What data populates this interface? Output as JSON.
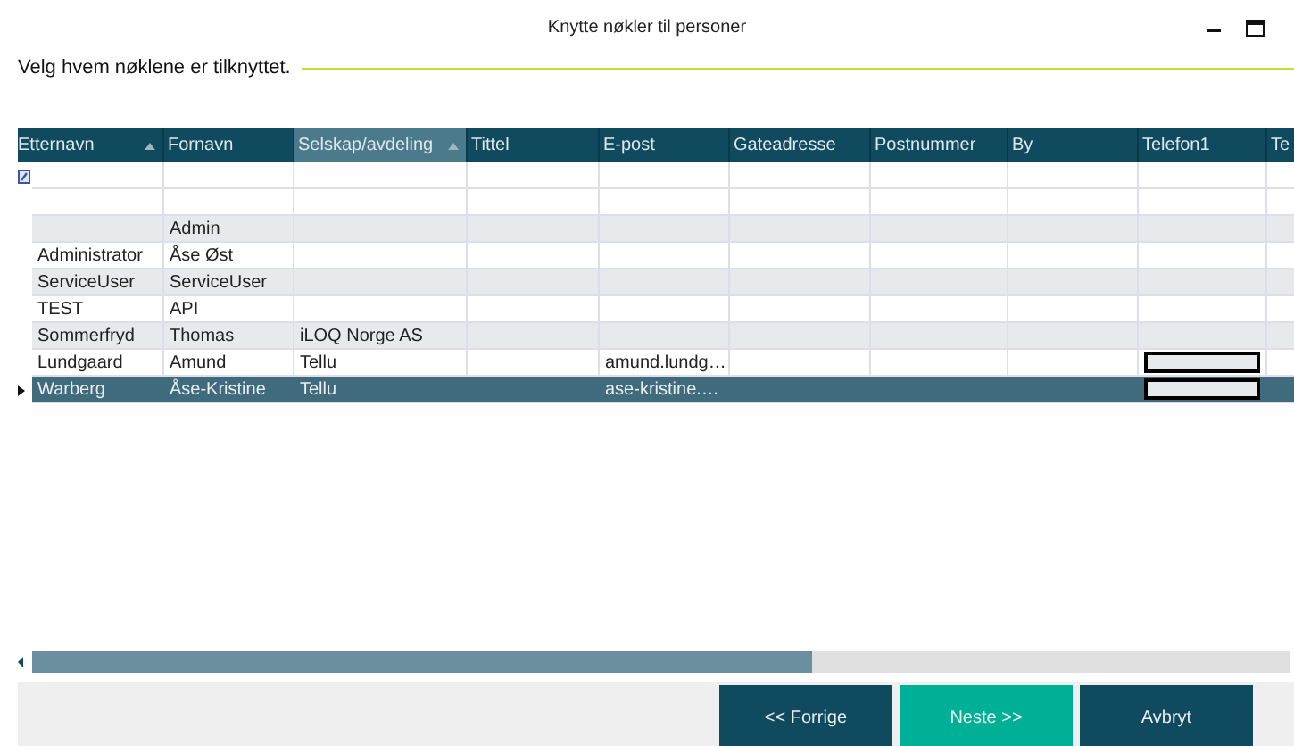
{
  "window": {
    "title": "Knytte nøkler til personer"
  },
  "heading": "Velg hvem nøklene er tilknyttet.",
  "table": {
    "columns": [
      {
        "label": "Etternavn",
        "sorted": true,
        "selected": false
      },
      {
        "label": "Fornavn",
        "sorted": false,
        "selected": false
      },
      {
        "label": "Selskap/avdeling",
        "sorted": true,
        "selected": true
      },
      {
        "label": "Tittel",
        "sorted": false,
        "selected": false
      },
      {
        "label": "E-post",
        "sorted": false,
        "selected": false
      },
      {
        "label": "Gateadresse",
        "sorted": false,
        "selected": false
      },
      {
        "label": "Postnummer",
        "sorted": false,
        "selected": false
      },
      {
        "label": "By",
        "sorted": false,
        "selected": false
      },
      {
        "label": "Telefon1",
        "sorted": false,
        "selected": false
      },
      {
        "label": "Te",
        "selected": false
      }
    ],
    "rows": [
      {
        "kind": "new",
        "selected": false
      },
      {
        "kind": "blank",
        "selected": false
      },
      {
        "kind": "data",
        "selected": false,
        "fornavn": "Admin"
      },
      {
        "kind": "data",
        "selected": false,
        "etternavn": "Administrator",
        "fornavn": "Åse Øst"
      },
      {
        "kind": "data",
        "selected": false,
        "etternavn": "ServiceUser",
        "fornavn": "ServiceUser"
      },
      {
        "kind": "data",
        "selected": false,
        "etternavn": "TEST",
        "fornavn": "API"
      },
      {
        "kind": "data",
        "selected": false,
        "etternavn": "Sommerfryd",
        "fornavn": "Thomas",
        "selskap_avdeling": "iLOQ Norge AS"
      },
      {
        "kind": "data",
        "selected": false,
        "etternavn": "Lundgaard",
        "fornavn": "Amund",
        "selskap_avdeling": "Tellu",
        "e_post": "amund.lundg…",
        "telefon1_focused": true
      },
      {
        "kind": "data",
        "selected": true,
        "etternavn": "Warberg",
        "fornavn": "Åse-Kristine",
        "selskap_avdeling": "Tellu",
        "e_post": "ase-kristine.…",
        "telefon1_focused": true
      }
    ]
  },
  "buttons": [
    {
      "label": "<< Forrige",
      "kind": "secondary"
    },
    {
      "label": "Neste >>",
      "kind": "primary"
    },
    {
      "label": "Avbryt",
      "kind": "secondary"
    }
  ]
}
